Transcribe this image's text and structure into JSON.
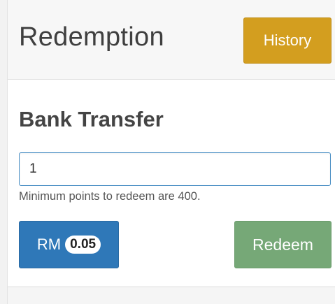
{
  "header": {
    "title": "Redemption",
    "history_label": "History"
  },
  "section": {
    "title": "Bank Transfer"
  },
  "points_input": {
    "value": "1"
  },
  "hint": "Minimum points to redeem are 400.",
  "rm_button": {
    "label": "RM",
    "amount": "0.05"
  },
  "redeem_button": {
    "label": "Redeem"
  },
  "colors": {
    "history": "#d39e1f",
    "rm": "#2f78b8",
    "redeem": "#76a877"
  }
}
